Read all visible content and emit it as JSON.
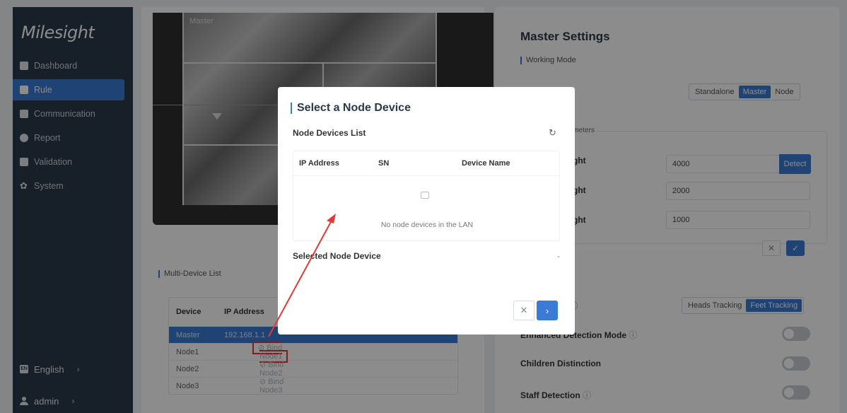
{
  "sidebar": {
    "logo": "Milesight",
    "items": [
      {
        "label": "Dashboard",
        "icon": "dashboard-icon"
      },
      {
        "label": "Rule",
        "icon": "rule-icon",
        "active": true
      },
      {
        "label": "Communication",
        "icon": "communication-icon"
      },
      {
        "label": "Report",
        "icon": "report-icon"
      },
      {
        "label": "Validation",
        "icon": "validation-icon"
      },
      {
        "label": "System",
        "icon": "gear-icon"
      }
    ],
    "language": "English",
    "language_icon": "EN",
    "user": "admin"
  },
  "left": {
    "video_label": "Master",
    "multi_device_title": "Multi-Device List",
    "table": {
      "headers": [
        "Device",
        "IP Address"
      ],
      "rows": [
        {
          "device": "Master",
          "ip": "192.168.1.1"
        },
        {
          "device": "Node1",
          "bind": "Bind Node1"
        },
        {
          "device": "Node2",
          "bind": "Bind Node2"
        },
        {
          "device": "Node3",
          "bind": "Bind Node3"
        }
      ]
    }
  },
  "right": {
    "title": "Master Settings",
    "working_mode": "Working Mode",
    "mode_options": [
      "Standalone",
      "Master",
      "Node"
    ],
    "mode_selected": "Master",
    "params_legend": "arameters",
    "height_labels": [
      "eight",
      "eight",
      "eight"
    ],
    "heights": [
      "4000",
      "2000",
      "1000"
    ],
    "detect": "Detect",
    "strategy_partial": "gy",
    "tracking_partial": "e",
    "tracking_options": [
      "Heads Tracking",
      "Feet Tracking"
    ],
    "tracking_selected": "Feet Tracking",
    "enhanced": "Enhanced Detection Mode",
    "children": "Children Distinction",
    "staff": "Staff Detection"
  },
  "modal": {
    "title": "Select a Node Device",
    "list_title": "Node Devices List",
    "headers": [
      "IP Address",
      "SN",
      "Device Name"
    ],
    "empty": "No node devices in the LAN",
    "selected_label": "Selected Node Device",
    "selected_value": "-"
  },
  "colors": {
    "accent": "#3a7bd5",
    "sidebar": "#2b3a4b",
    "annotation": "#e53935"
  }
}
